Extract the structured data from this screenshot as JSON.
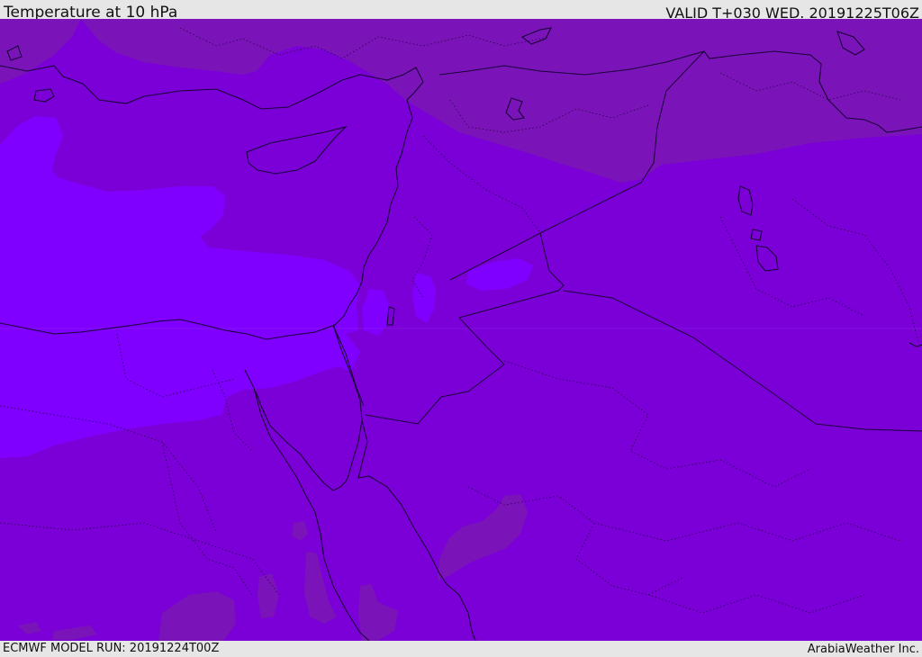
{
  "header": {
    "title": "Temperature at 10 hPa",
    "valid_time": "VALID T+030 WED. 20191225T06Z"
  },
  "footer": {
    "model_run": "ECMWF MODEL RUN: 20191224T00Z",
    "brand": "ArabiaWeather Inc."
  },
  "map": {
    "colors": {
      "base_field": "#7b00d8",
      "cold_field": "#7f00ff",
      "warm_field": "#7a14b8",
      "coastline": "#1a0038",
      "border": "#1a0038"
    }
  }
}
